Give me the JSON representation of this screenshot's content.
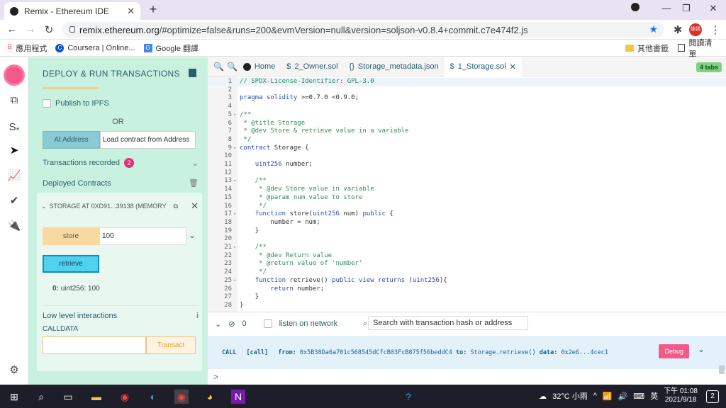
{
  "browser": {
    "tab_title": "Remix - Ethereum IDE",
    "url_host": "remix.ethereum.org",
    "url_rest": "/#optimize=false&runs=200&evmVersion=null&version=soljson-v0.8.4+commit.c7e474f2.js",
    "bookmarks": [
      "應用程式",
      "Coursera | Online...",
      "Google 翻譯"
    ],
    "bookmarks_right": [
      "其他書籤",
      "閱讀清單"
    ],
    "profile": "詠嫣"
  },
  "sidepanel": {
    "title": "DEPLOY & RUN TRANSACTIONS",
    "publish_ipfs": "Publish to IPFS",
    "or": "OR",
    "at_address": "At Address",
    "load_contract": "Load contract from Address",
    "transactions_recorded": "Transactions recorded",
    "transactions_count": "2",
    "deployed_contracts": "Deployed Contracts",
    "contract_title": "STORAGE AT 0XD91...39138 (MEMORY",
    "store_label": "store",
    "store_value": "100",
    "retrieve_label": "retrieve",
    "result_index": "0:",
    "result_value": "uint256: 100",
    "low_level": "Low level interactions",
    "calldata": "CALLDATA",
    "transact": "Transact"
  },
  "editor": {
    "tabs": [
      {
        "label": "Home",
        "icon": "remix-logo-icon"
      },
      {
        "label": "2_Owner.sol",
        "icon": "solidity-icon"
      },
      {
        "label": "Storage_metadata.json",
        "icon": "json-icon"
      },
      {
        "label": "1_Storage.sol",
        "icon": "solidity-icon"
      }
    ],
    "tabs_count": "4 tabs",
    "lines": [
      {
        "n": "1",
        "t": "// SPDX-License-Identifier: GPL-3.0",
        "f": ""
      },
      {
        "n": "2",
        "t": "",
        "f": ""
      },
      {
        "n": "3",
        "t": "pragma solidity >=0.7.0 <0.9.0;",
        "f": ""
      },
      {
        "n": "4",
        "t": "",
        "f": ""
      },
      {
        "n": "5",
        "t": "/**",
        "f": "▾"
      },
      {
        "n": "6",
        "t": " * @title Storage",
        "f": ""
      },
      {
        "n": "7",
        "t": " * @dev Store & retrieve value in a variable",
        "f": ""
      },
      {
        "n": "8",
        "t": " */",
        "f": ""
      },
      {
        "n": "9",
        "t": "contract Storage {",
        "f": "▾"
      },
      {
        "n": "10",
        "t": "",
        "f": ""
      },
      {
        "n": "11",
        "t": "    uint256 number;",
        "f": ""
      },
      {
        "n": "12",
        "t": "",
        "f": ""
      },
      {
        "n": "13",
        "t": "    /**",
        "f": "▾"
      },
      {
        "n": "14",
        "t": "     * @dev Store value in variable",
        "f": ""
      },
      {
        "n": "15",
        "t": "     * @param num value to store",
        "f": ""
      },
      {
        "n": "16",
        "t": "     */",
        "f": ""
      },
      {
        "n": "17",
        "t": "    function store(uint256 num) public {",
        "f": "▾"
      },
      {
        "n": "18",
        "t": "        number = num;",
        "f": ""
      },
      {
        "n": "19",
        "t": "    }",
        "f": ""
      },
      {
        "n": "20",
        "t": "",
        "f": ""
      },
      {
        "n": "21",
        "t": "    /**",
        "f": "▾"
      },
      {
        "n": "22",
        "t": "     * @dev Return value",
        "f": ""
      },
      {
        "n": "23",
        "t": "     * @return value of 'number'",
        "f": ""
      },
      {
        "n": "24",
        "t": "     */",
        "f": ""
      },
      {
        "n": "25",
        "t": "    function retrieve() public view returns (uint256){",
        "f": "▾"
      },
      {
        "n": "26",
        "t": "        return number;",
        "f": ""
      },
      {
        "n": "27",
        "t": "    }",
        "f": ""
      },
      {
        "n": "28",
        "t": "}",
        "f": ""
      }
    ]
  },
  "terminal": {
    "pending": "0",
    "listen": "listen on network",
    "search_placeholder": "Search with transaction hash or address",
    "call": "CALL",
    "tag": "[call]",
    "from_label": "from:",
    "from_value": "0x5B38Da6a701c568545dCfcB03FcB875f56beddC4",
    "to_label": "to:",
    "to_value": "Storage.retrieve()",
    "data_label": "data:",
    "data_value": "0x2e6...4cec1",
    "debug": "Debug",
    "prompt": ">"
  },
  "taskbar": {
    "weather": "32°C 小雨",
    "lang": "英",
    "time": "下午 01:08",
    "date": "2021/9/18",
    "notifications": "2"
  },
  "colors": {
    "side_bg": "#c9f1e0",
    "accent": "#2a5e6e",
    "badge": "#e62e7a",
    "debug": "#f25a8a"
  }
}
